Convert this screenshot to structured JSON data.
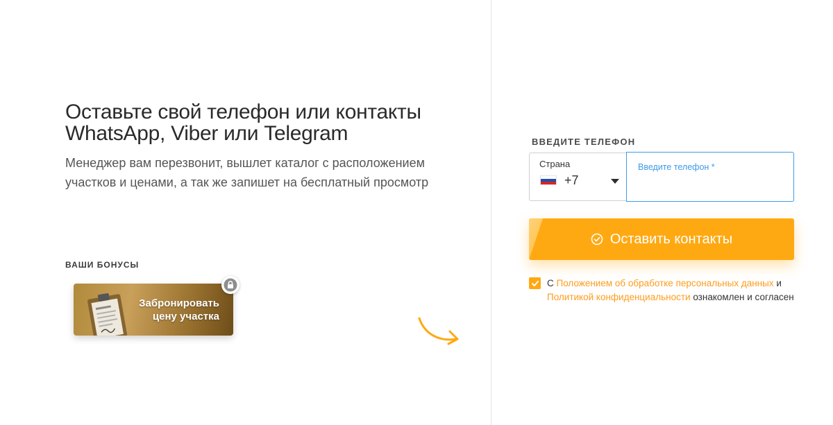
{
  "main": {
    "title": "Оставьте свой телефон или контакты WhatsApp, Viber или Telegram",
    "subtitle": "Менеджер вам перезвонит, вышлет каталог с расположением участков и ценами, а так же запишет на бесплатный просмотр",
    "bonuses_label": "ВАШИ БОНУСЫ",
    "bonus_card": {
      "line1": "Забронировать",
      "line2": "цену участка",
      "lock_icon": "lock-icon",
      "image_icon": "clipboard-icon"
    }
  },
  "form": {
    "label": "ВВЕДИТЕ ТЕЛЕФОН",
    "country": {
      "caption": "Страна",
      "code": "+7",
      "flag": "russia-flag-icon"
    },
    "phone": {
      "placeholder": "Введите телефон *",
      "value": ""
    },
    "submit_label": "Оставить контакты",
    "submit_icon": "check-circle-icon",
    "consent": {
      "checked": true,
      "prefix": "С ",
      "link1": "Положением об обработке персональных данных",
      "middle": " и ",
      "link2": "Политикой конфиденциальности",
      "suffix": " ознакомлен и согласен"
    }
  },
  "colors": {
    "accent": "#ffa912",
    "link": "#ff9b1a",
    "input_focus": "#3d9be9",
    "bonus_gold": "#b08a3c"
  }
}
